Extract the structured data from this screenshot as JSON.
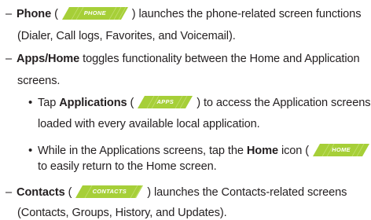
{
  "items": {
    "phone": {
      "dash": "–",
      "label": "Phone",
      "paren_open": "(",
      "badge": "PHONE",
      "paren_close": ")",
      "text_line1": " launches the phone-related screen functions",
      "text_line2": "(Dialer, Call logs, Favorites, and Voicemail)."
    },
    "apps_home": {
      "dash": "–",
      "label": "Apps/Home",
      "text_line1": " toggles functionality between the Home and Application",
      "text_line2": "screens."
    },
    "applications": {
      "bullet": "•",
      "prefix": "Tap ",
      "label": "Applications",
      "paren_open": " (",
      "badge": "APPS",
      "paren_close": ")",
      "text_line1": " to access the Application screens",
      "text_line2": "loaded with every available local application."
    },
    "home": {
      "bullet": "•",
      "prefix": "While in the Applications screens, tap the ",
      "label": "Home",
      "suffix": " icon (",
      "badge": "HOME",
      "paren_close": ")",
      "text_line2": "to easily return to the Home screen."
    },
    "contacts": {
      "dash": "–",
      "label": "Contacts",
      "paren_open": " (",
      "badge": "CONTACTS",
      "paren_close": ")",
      "text_line1": " launches the Contacts-related screens",
      "text_line2": "(Contacts, Groups, History, and Updates)."
    }
  },
  "colors": {
    "badge_fill": "#a6cf38",
    "badge_stripe": "#c9e37c",
    "badge_text": "#ffffff",
    "text": "#231f20"
  }
}
